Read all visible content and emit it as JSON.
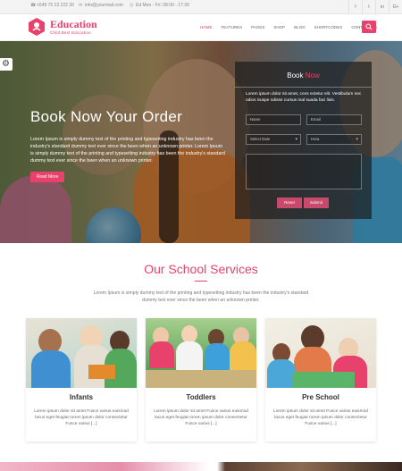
{
  "topbar": {
    "phone": "+549 75 23 222 36",
    "email": "info@yourmail.com",
    "hours": "Ed Mon - Fri: 08:00 - 17:30",
    "social": [
      "f",
      "t",
      "in",
      "G+"
    ]
  },
  "header": {
    "logo_title": "Education",
    "logo_subtitle": "Child Best Education",
    "nav": [
      "HOME",
      "FEATURES",
      "PAGES",
      "SHOP",
      "BLOG",
      "SHORTCODES",
      "CONTACT US"
    ],
    "active_nav": "HOME"
  },
  "hero": {
    "title": "Book Now Your Order",
    "text": "Lorem Ipsum is simply dummy text of the printing and typesetting industry has been the industry's standard dummy text ever since the been when an unknown printer. Lorem Ipsum is simply dummy text of the printing and typesetting industry has been the industry's standard dummy text ever since the been when an unknown printer.",
    "button": "Read More"
  },
  "booking": {
    "title_main": "Book",
    "title_accent": "Now",
    "description": "Lorem ipsum dolor sit amet, cons ectetur elit. Vestibulum nec odios Suspe ndisse cursus mal suada faci lisis.",
    "name_placeholder": "Name",
    "email_placeholder": "Email",
    "date_placeholder": "Select Date",
    "time_placeholder": "Hora",
    "reset_button": "Reset",
    "submit_button": "Submit"
  },
  "services": {
    "title": "Our School Services",
    "description": "Lorem Ipsum is simply dummy text of the printing and typesetting industry has been the industry's standard dummy text ever since the been when an unknown printer.",
    "cards": [
      {
        "title": "Infants",
        "text": "Lorem ipsum dolor sit amet Fusce varius euismod lacus eget feugiat rorem ipsum dolor consectetur Fusce varius [...]"
      },
      {
        "title": "Toddlers",
        "text": "Lorem ipsum dolor sit amet Fusce varius euismod lacus eget feugiat rorem ipsum dolor consectetur Fusce varius [...]"
      },
      {
        "title": "Pre School",
        "text": "Lorem ipsum dolor sit amet Fusce varius euismod lacus eget feugiat rorem ipsum dolor consectetur Fusce varius [...]"
      }
    ]
  },
  "colors": {
    "accent": "#e8416c",
    "topbar_bg": "#f3f3f3",
    "text": "#555555"
  },
  "icons": [
    "phone-icon",
    "email-icon",
    "clock-icon",
    "facebook-icon",
    "twitter-icon",
    "linkedin-icon",
    "google-plus-icon",
    "search-icon",
    "gear-icon",
    "logo-icon"
  ]
}
